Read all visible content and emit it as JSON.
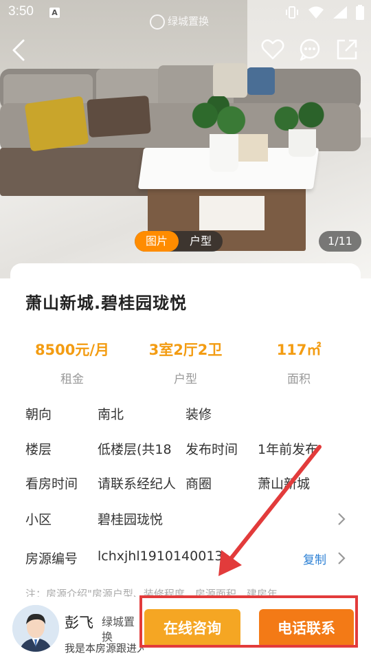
{
  "status_bar": {
    "time": "3:50",
    "keyboard_indicator": "A",
    "brand": "绿城置换",
    "icons": [
      "vibrate-icon",
      "wifi-icon",
      "signal-icon",
      "battery-icon"
    ]
  },
  "top_nav": {
    "back": "back-icon",
    "actions": [
      "favorite-icon",
      "message-icon",
      "share-icon"
    ]
  },
  "media": {
    "tabs": [
      "图片",
      "户型"
    ],
    "active_tab": "图片",
    "counter": "1/11"
  },
  "listing": {
    "title": "萧山新城.碧桂园珑悦",
    "metrics": [
      {
        "value": "8500元/月",
        "label": "租金"
      },
      {
        "value": "3室2厅2卫",
        "label": "户型"
      },
      {
        "value": "117㎡",
        "label": "面积"
      }
    ],
    "details": [
      {
        "k": "朝向",
        "v": "南北",
        "k2": "装修",
        "v2": ""
      },
      {
        "k": "楼层",
        "v": "低楼层(共18",
        "k2": "发布时间",
        "v2": "1年前发布"
      },
      {
        "k": "看房时间",
        "v": "请联系经纪人",
        "k2": "商圈",
        "v2": "萧山新城"
      }
    ],
    "community": {
      "k": "小区",
      "v": "碧桂园珑悦"
    },
    "listing_id": {
      "k": "房源编号",
      "v": "lchxjhl1910140013",
      "action": "复制"
    },
    "note": "注：房源介绍\"房源户型、装修程度、房源面积、建房年"
  },
  "agent": {
    "name": "彭飞",
    "company": "绿城置换",
    "intro": "我是本房源跟进人"
  },
  "cta": {
    "chat": "在线咨询",
    "call": "电话联系"
  },
  "colors": {
    "accent": "#f39c12",
    "cta_chat": "#f5a623",
    "cta_call": "#f37a16",
    "annotation": "#e23b3b",
    "link": "#2a7fd4"
  }
}
